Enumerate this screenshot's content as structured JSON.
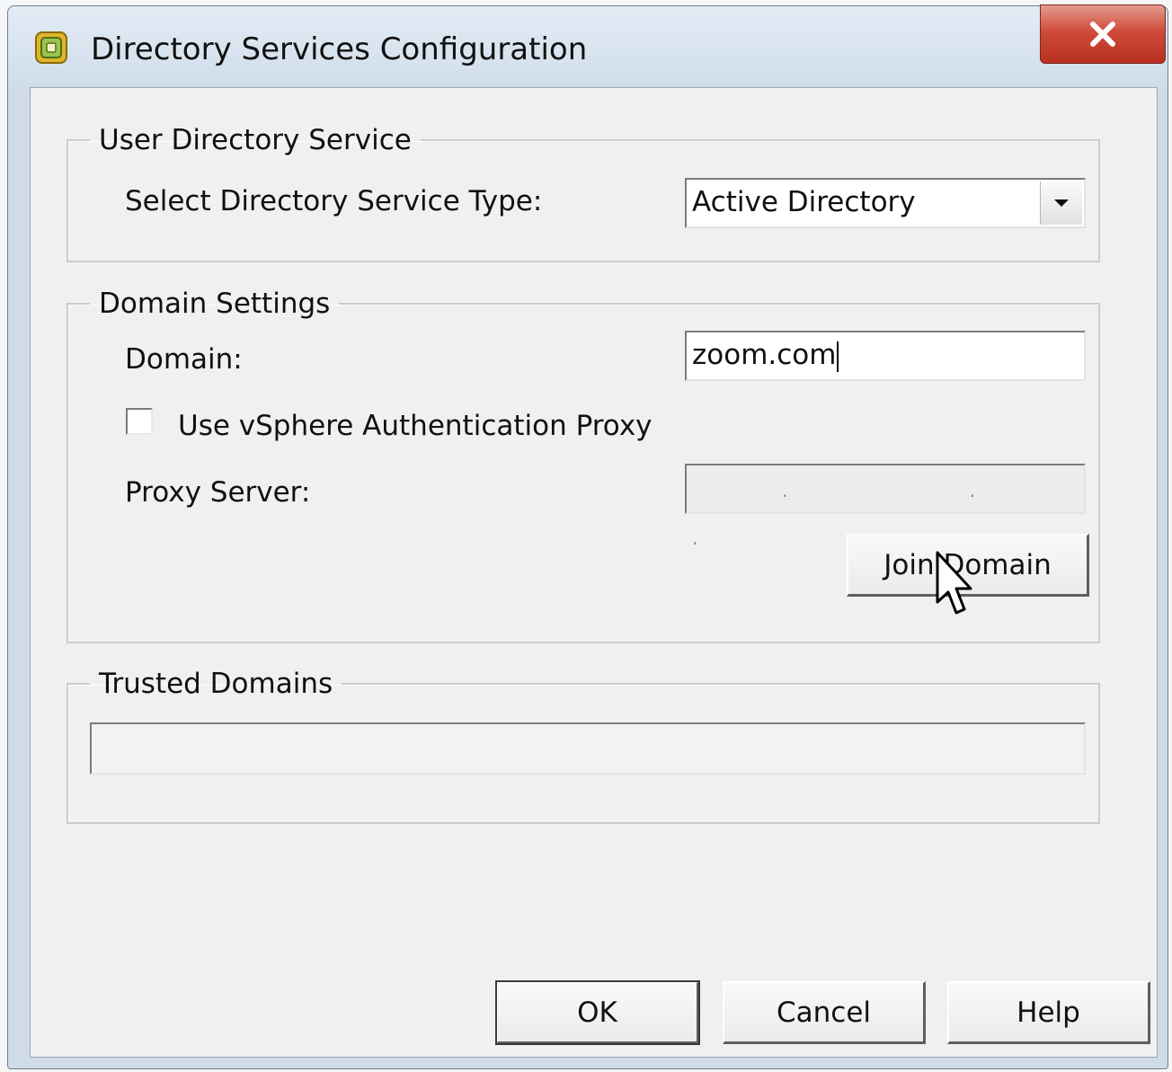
{
  "window": {
    "title": "Directory Services Configuration",
    "close_label": "X"
  },
  "user_directory": {
    "legend": "User Directory Service",
    "type_label": "Select Directory Service Type:",
    "type_value": "Active Directory"
  },
  "domain_settings": {
    "legend": "Domain Settings",
    "domain_label": "Domain:",
    "domain_value": "zoom.com",
    "proxy_checkbox_label": "Use vSphere Authentication Proxy",
    "proxy_checkbox_checked": false,
    "proxy_server_label": "Proxy Server:",
    "proxy_server_value": ". . .",
    "join_button": "Join Domain"
  },
  "trusted_domains": {
    "legend": "Trusted Domains"
  },
  "buttons": {
    "ok": "OK",
    "cancel": "Cancel",
    "help": "Help"
  },
  "colors": {
    "close_button": "#c9402f",
    "icon_gold": "#e8b820",
    "icon_green": "#8ab640"
  }
}
